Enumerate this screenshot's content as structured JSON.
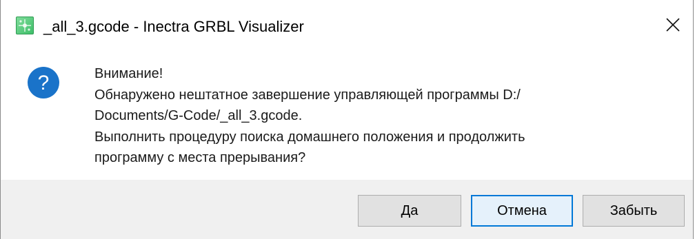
{
  "window": {
    "title": "_all_3.gcode - Inectra GRBL Visualizer",
    "app_icon": "app-logo-icon",
    "close_icon": "close-icon"
  },
  "message": {
    "icon": "question-icon",
    "icon_color": "#1a73c9",
    "lines": [
      "Внимание!",
      "Обнаружено нештатное завершение управляющей программы D:/",
      "Documents/G-Code/_all_3.gcode.",
      "Выполнить процедуру поиска домашнего положения и продолжить",
      "программу с места прерывания?"
    ]
  },
  "buttons": {
    "yes": "Да",
    "cancel": "Отмена",
    "forget": "Забыть",
    "default_accent": "#0078d7"
  }
}
